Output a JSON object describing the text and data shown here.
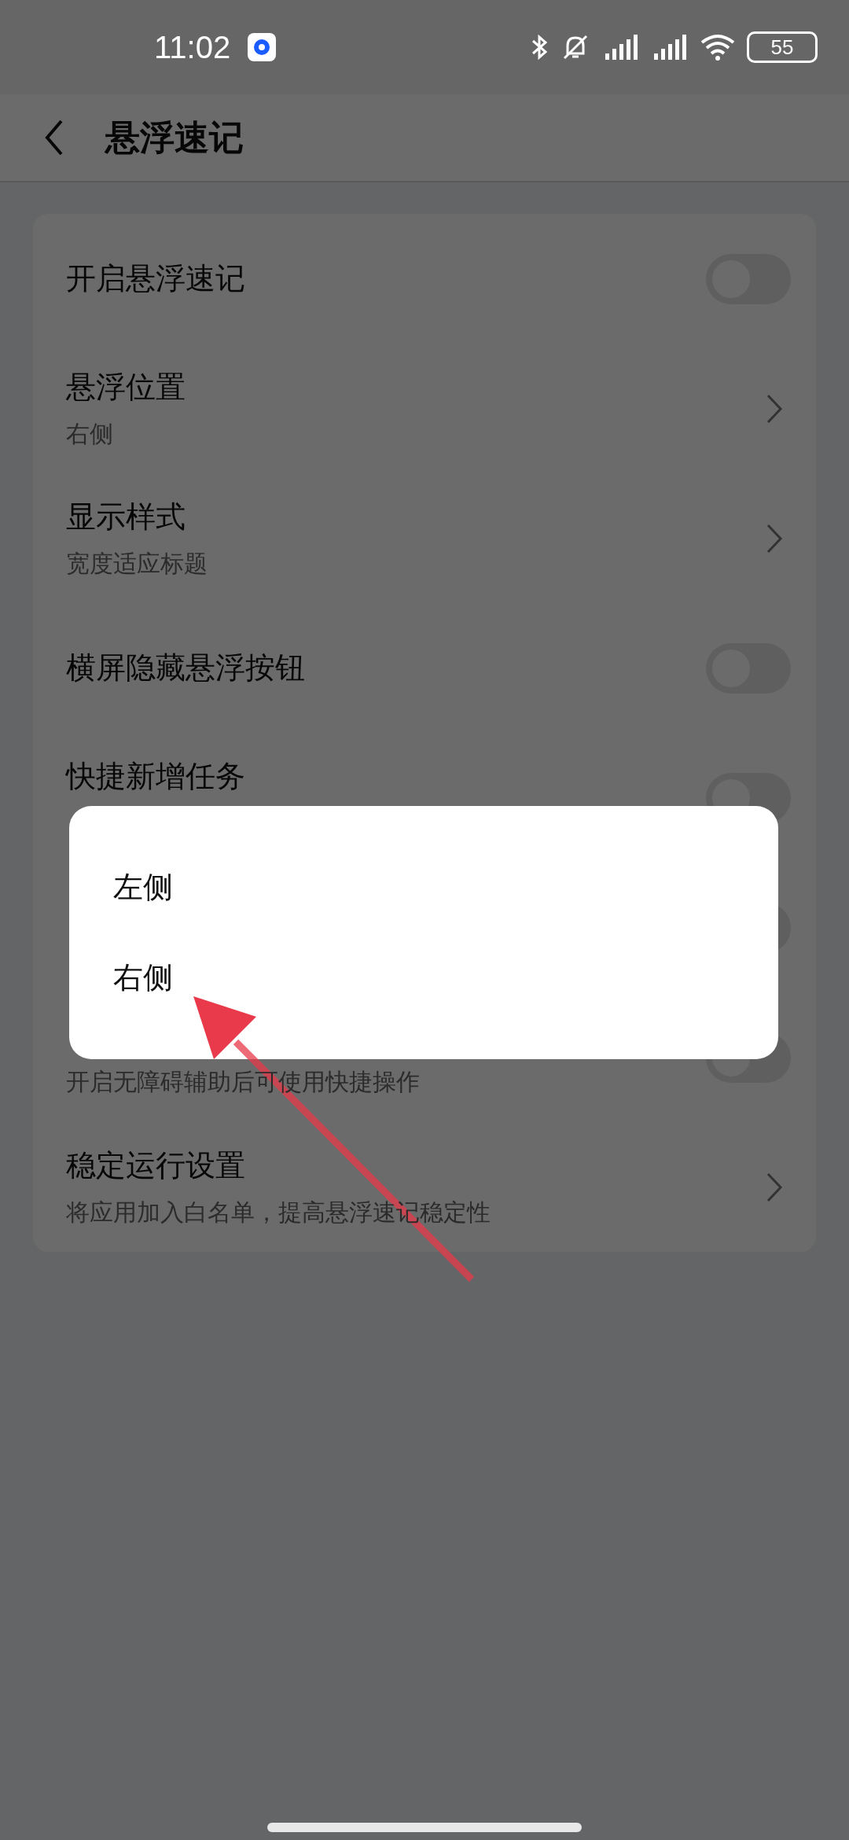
{
  "status_bar": {
    "time": "11:02",
    "battery": "55"
  },
  "header": {
    "title": "悬浮速记"
  },
  "settings": [
    {
      "kind": "toggle",
      "title": "开启悬浮速记",
      "on": false
    },
    {
      "kind": "link",
      "title": "悬浮位置",
      "subtitle": "右侧"
    },
    {
      "kind": "link",
      "title": "显示样式",
      "subtitle": "宽度适应标题"
    },
    {
      "kind": "toggle",
      "title": "横屏隐藏悬浮按钮",
      "on": false
    },
    {
      "kind": "toggle",
      "title": "快捷新增任务",
      "on": false
    },
    {
      "kind": "toggle",
      "on": false
    },
    {
      "kind": "toggle",
      "subtitle": "开启无障碍辅助后可使用快捷操作",
      "on": false
    },
    {
      "kind": "link",
      "title": "稳定运行设置",
      "subtitle": "将应用加入白名单，提高悬浮速记稳定性"
    }
  ],
  "popup": {
    "options": [
      "左侧",
      "右侧"
    ]
  }
}
